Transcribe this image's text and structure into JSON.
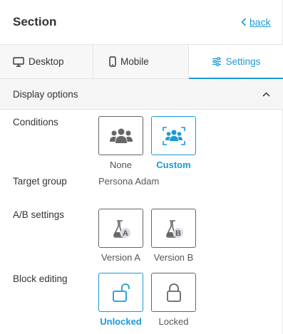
{
  "header": {
    "title": "Section",
    "back_label": "back"
  },
  "tabs": [
    {
      "label": "Desktop",
      "icon": "monitor-icon"
    },
    {
      "label": "Mobile",
      "icon": "mobile-icon"
    },
    {
      "label": "Settings",
      "icon": "sliders-icon",
      "active": true
    }
  ],
  "display_options": {
    "label": "Display options",
    "expanded": true
  },
  "conditions": {
    "label": "Conditions",
    "options": [
      {
        "caption": "None",
        "icon": "group-icon",
        "selected": false
      },
      {
        "caption": "Custom",
        "icon": "group-focus-icon",
        "selected": true
      }
    ]
  },
  "target_group": {
    "label": "Target group",
    "value": "Persona Adam"
  },
  "ab_settings": {
    "label": "A/B settings",
    "options": [
      {
        "caption": "Version A",
        "icon": "flask-a-icon",
        "badge": "A"
      },
      {
        "caption": "Version B",
        "icon": "flask-b-icon",
        "badge": "B"
      }
    ]
  },
  "block_editing": {
    "label": "Block editing",
    "options": [
      {
        "caption": "Unlocked",
        "icon": "unlock-icon",
        "selected": true
      },
      {
        "caption": "Locked",
        "icon": "lock-icon",
        "selected": false
      }
    ]
  },
  "colors": {
    "accent": "#1a9ad6",
    "text": "#333333",
    "icon_gray": "#666666"
  }
}
